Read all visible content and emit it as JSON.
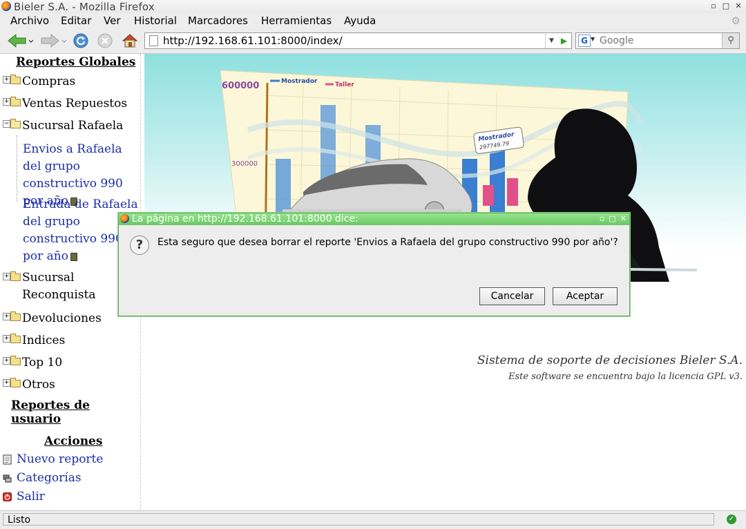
{
  "window": {
    "title": "Bieler S.A. - Mozilla Firefox"
  },
  "menu": [
    "Archivo",
    "Editar",
    "Ver",
    "Historial",
    "Marcadores",
    "Herramientas",
    "Ayuda"
  ],
  "toolbar": {
    "url": "http://192.168.61.101:8000/index/",
    "search_placeholder": "Google"
  },
  "sidebar": {
    "global_title": "Reportes Globales",
    "tree": [
      {
        "label": "Compras",
        "expanded": false
      },
      {
        "label": "Ventas Repuestos",
        "expanded": false
      },
      {
        "label": "Sucursal Rafaela",
        "expanded": true
      },
      {
        "label": "Sucursal Reconquista",
        "expanded": false
      },
      {
        "label": "Devoluciones",
        "expanded": false
      },
      {
        "label": "Indices",
        "expanded": false
      },
      {
        "label": "Top 10",
        "expanded": false
      },
      {
        "label": "Otros",
        "expanded": false
      }
    ],
    "rafaela_reports": [
      "Envios a Rafaela del grupo constructivo 990 por año",
      "Entrada de Rafaela del grupo constructivo 990 por año"
    ],
    "user_title": "Reportes de usuario",
    "actions_title": "Acciones",
    "actions": [
      "Nuevo reporte",
      "Categorías",
      "Salir"
    ]
  },
  "hero": {
    "legend": [
      "Mostrador",
      "Taller"
    ],
    "axis_labels": [
      "600000",
      "300000"
    ],
    "tooltip_name": "Mostrador",
    "tooltip_value": "297749.79",
    "colors": {
      "mostrador": "#3a7fd1",
      "taller": "#e0508a"
    }
  },
  "footer": {
    "line1": "Sistema de soporte de decisiones Bieler S.A.",
    "line2": "Este software se encuentra bajo la licencia GPL v3."
  },
  "dialog": {
    "title": "La página en http://192.168.61.101:8000 dice:",
    "message": "Esta seguro que desea borrar el reporte 'Envios a Rafaela del grupo constructivo 990 por año'?",
    "cancel": "Cancelar",
    "accept": "Aceptar"
  },
  "status": {
    "text": "Listo"
  }
}
